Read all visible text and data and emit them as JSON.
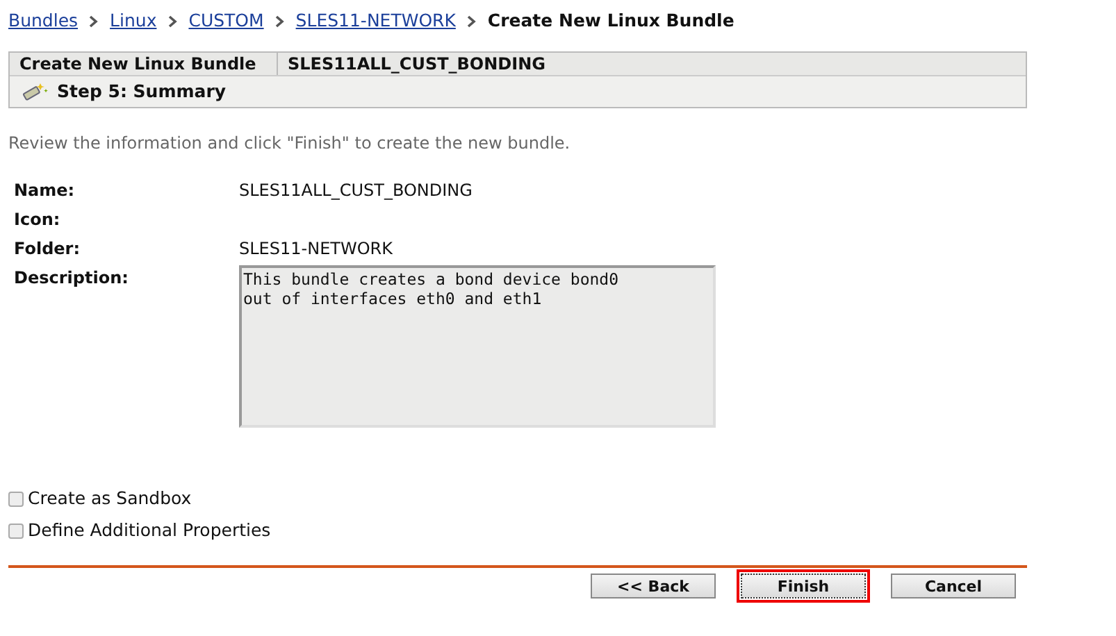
{
  "breadcrumb": {
    "links": [
      "Bundles",
      "Linux",
      "CUSTOM",
      "SLES11-NETWORK"
    ],
    "current": "Create New Linux Bundle"
  },
  "header": {
    "title": "Create New Linux Bundle",
    "bundle_name": "SLES11ALL_CUST_BONDING",
    "step": "Step 5: Summary"
  },
  "intro": "Review the information and click \"Finish\" to create the new bundle.",
  "fields": [
    {
      "label": "Name:",
      "value": "SLES11ALL_CUST_BONDING",
      "kind": "text"
    },
    {
      "label": "Icon:",
      "kind": "empty"
    },
    {
      "label": "Folder:",
      "value": "SLES11-NETWORK",
      "kind": "text"
    },
    {
      "label": "Description:",
      "value": "This bundle creates a bond device bond0\nout of interfaces eth0 and eth1",
      "kind": "textarea"
    }
  ],
  "options": [
    {
      "label": "Create as Sandbox",
      "checked": false
    },
    {
      "label": "Define Additional Properties",
      "checked": false
    }
  ],
  "buttons": [
    {
      "label": "<< Back",
      "focused": false
    },
    {
      "label": "Finish",
      "focused": true
    },
    {
      "label": "Cancel",
      "focused": false
    }
  ]
}
